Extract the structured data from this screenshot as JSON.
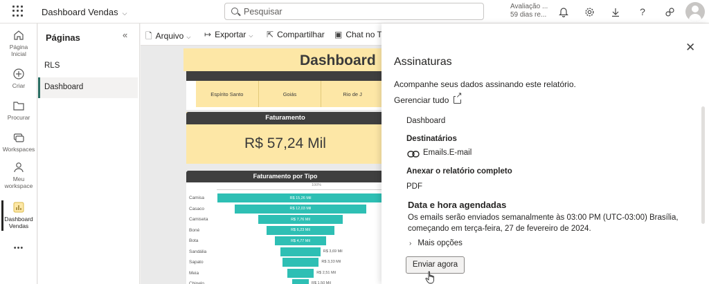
{
  "topbar": {
    "app_title": "Dashboard Vendas",
    "search_placeholder": "Pesquisar",
    "trial_line1": "Avaliação ...",
    "trial_line2": "59 dias re..."
  },
  "rail": {
    "items": [
      {
        "label1": "Página",
        "label2": "Inicial",
        "icon": "home-icon"
      },
      {
        "label1": "Criar",
        "label2": "",
        "icon": "plus-circle-icon"
      },
      {
        "label1": "Procurar",
        "label2": "",
        "icon": "folder-icon"
      },
      {
        "label1": "Workspaces",
        "label2": "",
        "icon": "workspaces-icon"
      },
      {
        "label1": "Meu",
        "label2": "workspace",
        "icon": "person-icon"
      },
      {
        "label1": "Dashboard",
        "label2": "Vendas",
        "icon": "report-icon"
      }
    ],
    "more": "•••"
  },
  "pages": {
    "title": "Páginas",
    "items": [
      "RLS",
      "Dashboard"
    ],
    "selected": "Dashboard"
  },
  "toolbar": {
    "file": "Arquivo",
    "export": "Exportar",
    "share": "Compartilhar",
    "chat": "Chat no Te"
  },
  "report": {
    "title": "Dashboard",
    "filters": [
      "Espírito Santo",
      "Goiás",
      "Rio de J"
    ],
    "revenue_header": "Faturamento",
    "revenue_value": "R$ 57,24 Mil",
    "funnel_header": "Faturamento por Tipo",
    "funnel_pct": "100%",
    "funnel": [
      {
        "label": "Camisa",
        "value": "R$ 15,26 Mil",
        "share": 1.0
      },
      {
        "label": "Casaco",
        "value": "R$ 12,03 Mil",
        "share": 0.79
      },
      {
        "label": "Camiseta",
        "value": "R$ 7,76 Mil",
        "share": 0.51
      },
      {
        "label": "Boné",
        "value": "R$ 6,23 Mil",
        "share": 0.41
      },
      {
        "label": "Bota",
        "value": "R$ 4,77 Mil",
        "share": 0.31
      },
      {
        "label": "Sandália",
        "value": "R$ 3,69 Mil",
        "share": 0.24
      },
      {
        "label": "Sapato",
        "value": "R$ 3,33 Mil",
        "share": 0.22
      },
      {
        "label": "Meia",
        "value": "R$ 2,51 Mil",
        "share": 0.16
      },
      {
        "label": "Chinelo",
        "value": "R$ 1,50 Mil",
        "share": 0.1
      }
    ]
  },
  "panel": {
    "title": "Assinaturas",
    "description": "Acompanhe seus dados assinando este relatório.",
    "manage": "Gerenciar tudo",
    "dashboard_name": "Dashboard",
    "recipients_label": "Destinatários",
    "recipients_value": "Emails.E-mail",
    "attach_label": "Anexar o relatório completo",
    "attach_value": "PDF",
    "schedule_title": "Data e hora agendadas",
    "schedule_desc": "Os emails serão enviados semanalmente às 03:00 PM (UTC-03:00) Brasília, começando em terça-feira, 27 de fevereiro de 2024.",
    "more_options": "Mais opções",
    "send_now": "Enviar agora"
  },
  "colors": {
    "accent": "#2b6e63",
    "report_yellow": "#fde7a6",
    "funnel_teal": "#2ebfb4",
    "header_dark": "#3f3f3f"
  }
}
